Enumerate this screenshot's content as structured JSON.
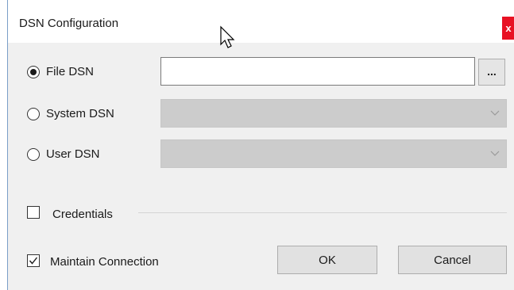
{
  "window": {
    "title": "DSN Configuration",
    "close_glyph": "x"
  },
  "dsn_options": [
    {
      "label": "File DSN",
      "selected": true
    },
    {
      "label": "System DSN",
      "selected": false
    },
    {
      "label": "User DSN",
      "selected": false
    }
  ],
  "file_dsn": {
    "value": "",
    "browse_label": "..."
  },
  "credentials": {
    "label": "Credentials",
    "checked": false
  },
  "maintain_connection": {
    "label": "Maintain Connection",
    "checked": true
  },
  "buttons": {
    "ok": "OK",
    "cancel": "Cancel"
  },
  "colors": {
    "close_bg": "#e81123",
    "dialog_bg": "#f0f0f0",
    "disabled_select": "#cccccc"
  },
  "icons": {
    "cursor": "mouse-pointer-icon",
    "dropdown": "chevron-down-icon",
    "checkmark": "checkmark-icon"
  }
}
